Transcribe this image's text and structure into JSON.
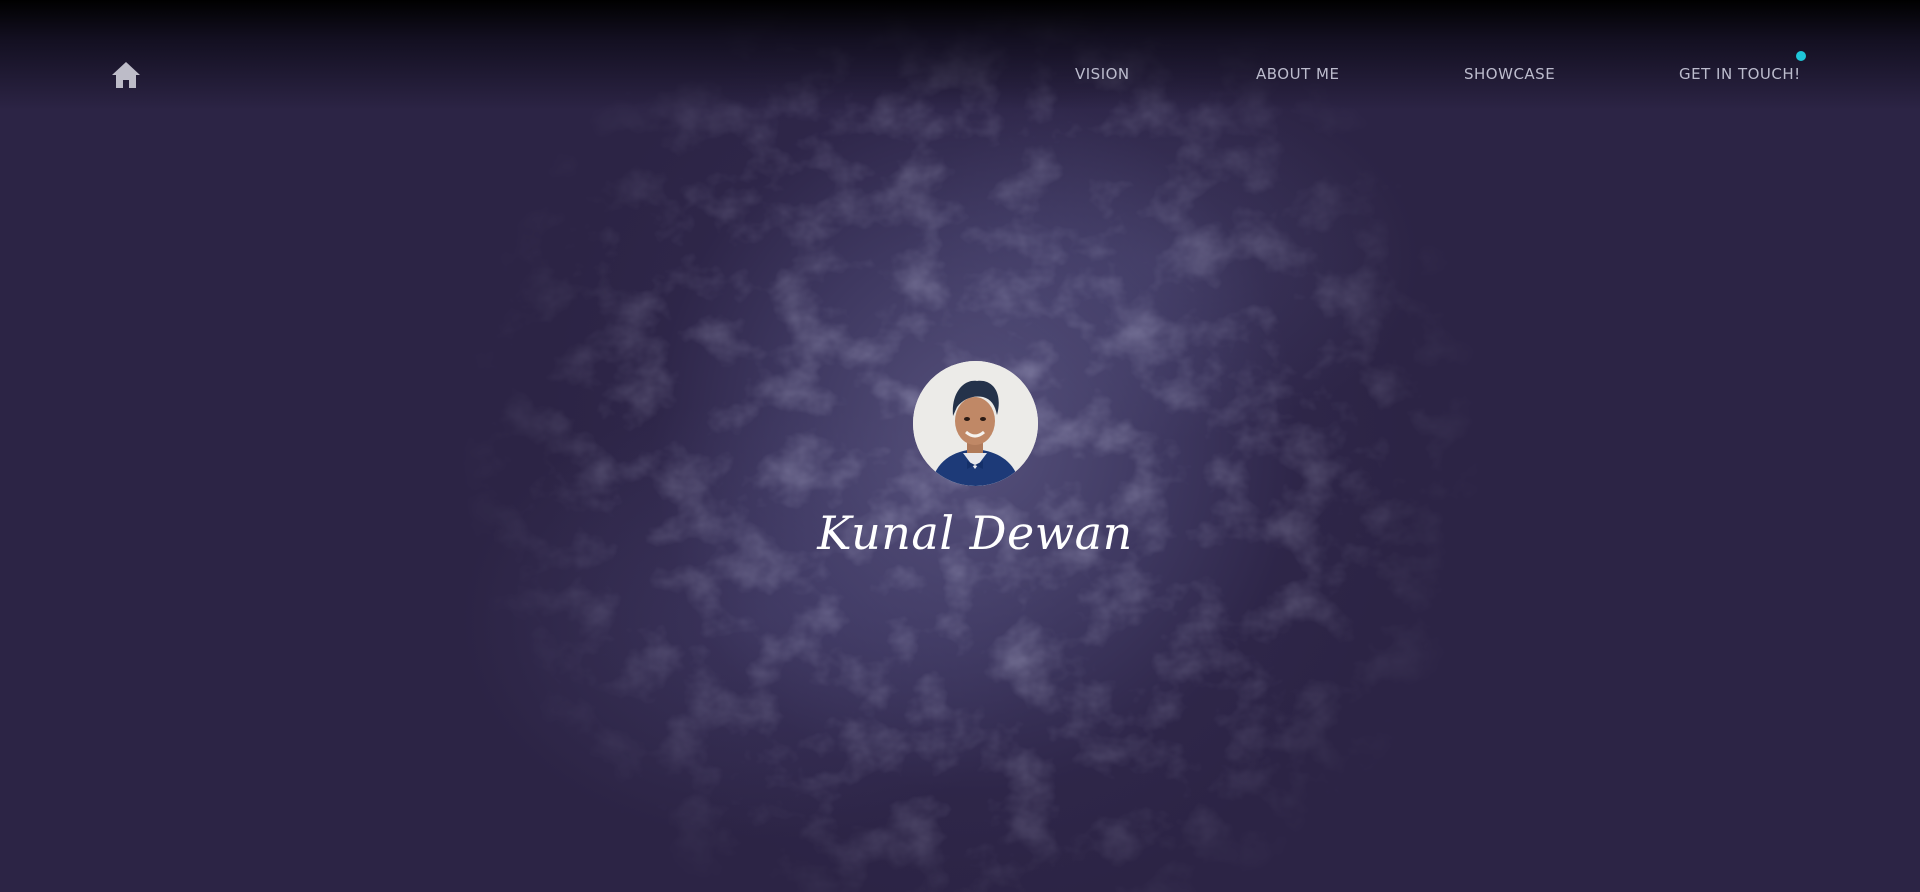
{
  "nav": {
    "home_icon": "home-icon",
    "links": [
      {
        "label": "VISION"
      },
      {
        "label": "ABOUT ME"
      },
      {
        "label": "SHOWCASE"
      },
      {
        "label": "GET IN TOUCH!"
      }
    ],
    "notification_color": "#1fc6d8"
  },
  "hero": {
    "name": "Kunal Dewan",
    "avatar_icon": "profile-photo"
  },
  "colors": {
    "background": "#2c2445",
    "nav_text": "#bcbccd",
    "accent": "#1fc6d8"
  }
}
